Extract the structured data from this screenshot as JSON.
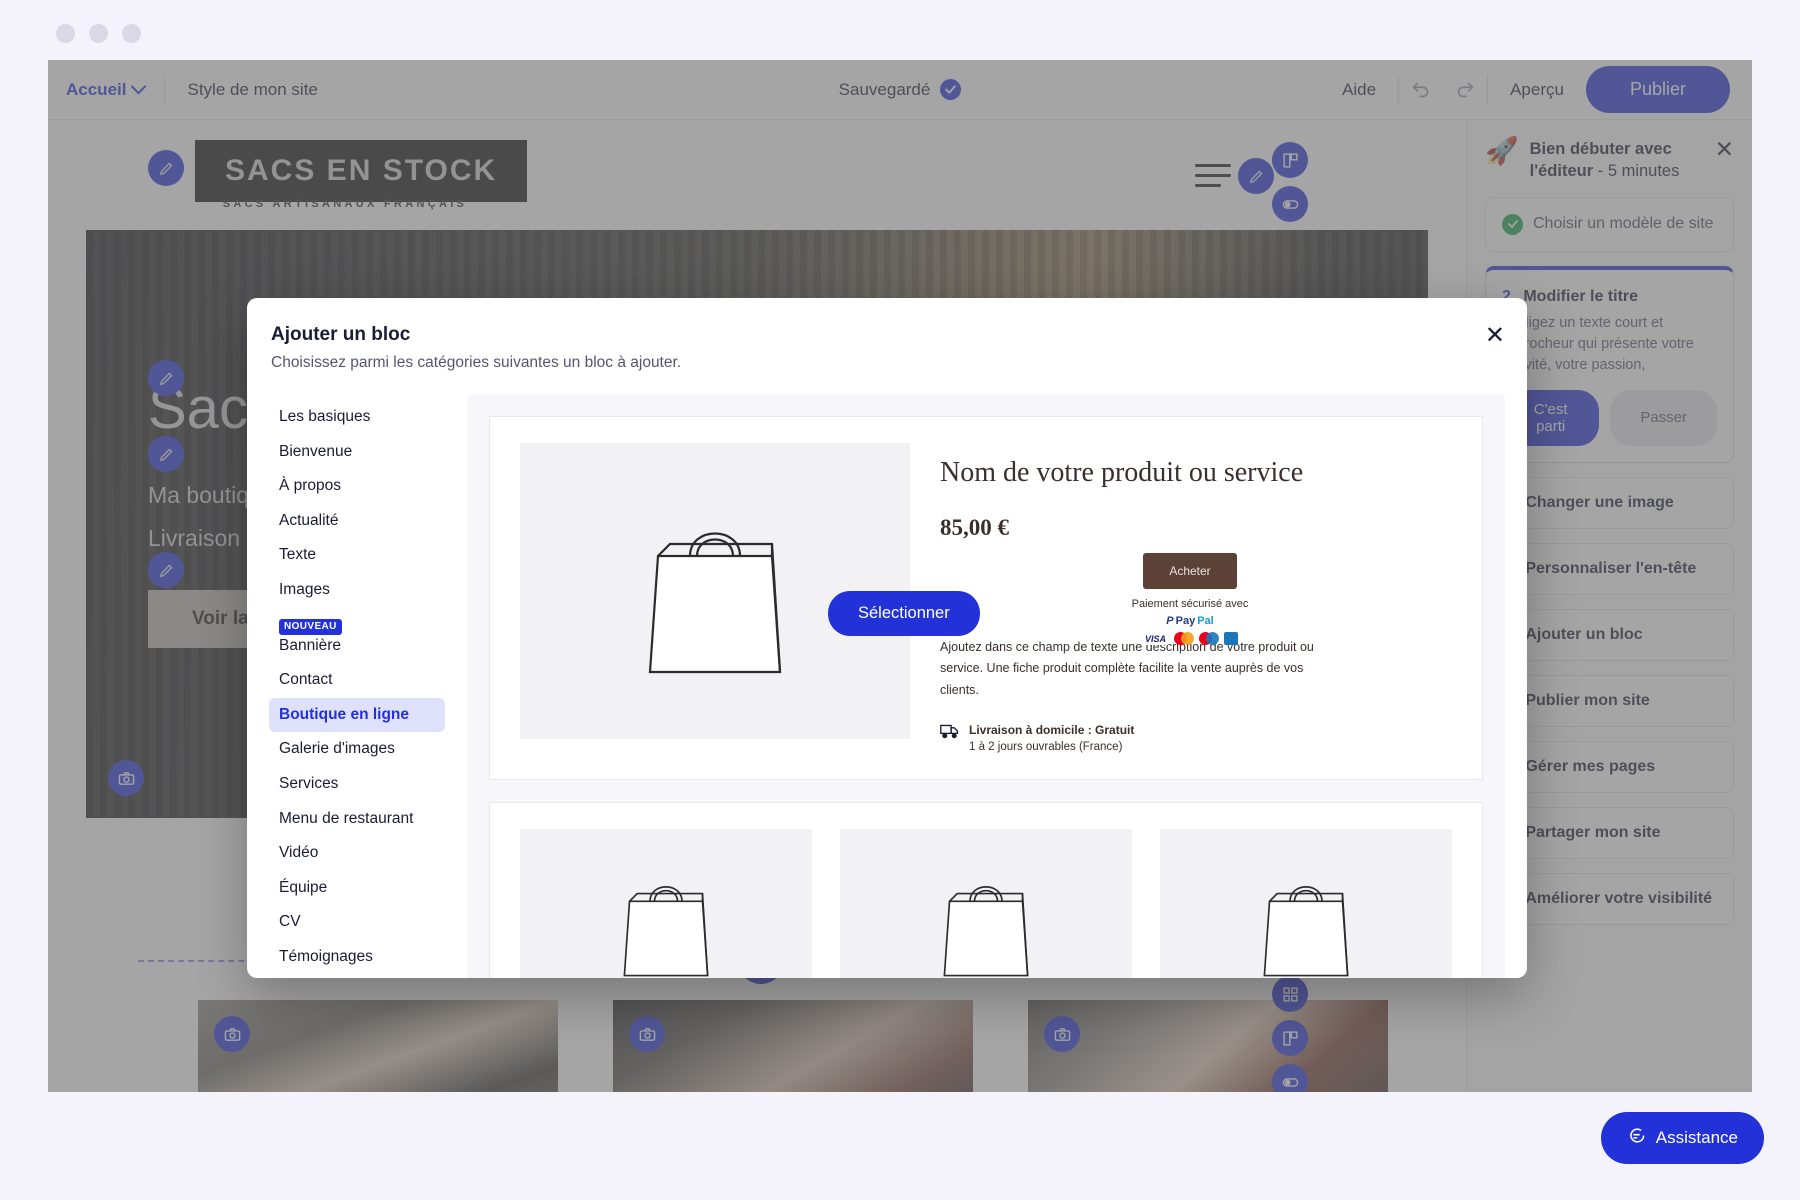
{
  "topbar": {
    "accueil": "Accueil",
    "chevron_icon": "chevron-down-icon",
    "style_label": "Style de mon site",
    "saved_label": "Sauvegardé",
    "saved_icon": "check-circle-icon",
    "help_label": "Aide",
    "undo_icon": "undo-icon",
    "redo_icon": "redo-icon",
    "preview_label": "Aperçu",
    "publish_label": "Publier"
  },
  "site": {
    "logo_text": "SACS EN STOCK",
    "logo_tagline": "SACS ARTISANAUX FRANÇAIS",
    "menu_icon": "hamburger-menu-icon",
    "hero_title": "Sacs",
    "hero_line1": "Ma boutique",
    "hero_line2": "Livraison g",
    "hero_button": "Voir la b",
    "camera_icon": "camera-icon",
    "pencil_icon": "pencil-edit-icon",
    "add_block_icon": "plus-icon"
  },
  "right_panel": {
    "title_bold": "Bien débuter avec l'éditeur",
    "title_rest": " - 5 minutes",
    "rocket_icon": "rocket-icon",
    "close_icon": "close-icon",
    "items": [
      {
        "label": "Choisir un modèle de site",
        "state": "done"
      },
      {
        "label": "Modifier le titre",
        "state": "active",
        "desc": "Rédigez un texte court et accrocheur qui présente votre activité, votre passion,",
        "cta": "C'est parti",
        "skip": "Passer"
      },
      {
        "label": "Changer une image",
        "state": "todo"
      },
      {
        "label": "Personnaliser l'en-tête",
        "state": "todo"
      },
      {
        "label": "Ajouter un bloc",
        "state": "todo"
      },
      {
        "label": "Publier mon site",
        "state": "todo"
      },
      {
        "label": "Gérer mes pages",
        "state": "todo"
      },
      {
        "label": "Partager mon site",
        "state": "todo"
      },
      {
        "label": "Améliorer votre visibilité",
        "state": "todo"
      }
    ],
    "assistance_label": "Assistance",
    "assistance_icon": "chat-bubble-icon"
  },
  "modal": {
    "title": "Ajouter un bloc",
    "subtitle": "Choisissez parmi les catégories suivantes un bloc à ajouter.",
    "close_icon": "close-icon",
    "categories": [
      {
        "label": "Les basiques",
        "selected": false
      },
      {
        "label": "Bienvenue",
        "selected": false
      },
      {
        "label": "À propos",
        "selected": false
      },
      {
        "label": "Actualité",
        "selected": false
      },
      {
        "label": "Texte",
        "selected": false
      },
      {
        "label": "Images",
        "selected": false
      },
      {
        "label": "Bannière",
        "selected": false,
        "badge": "NOUVEAU"
      },
      {
        "label": "Contact",
        "selected": false
      },
      {
        "label": "Boutique en ligne",
        "selected": true
      },
      {
        "label": "Galerie d'images",
        "selected": false
      },
      {
        "label": "Services",
        "selected": false
      },
      {
        "label": "Menu de restaurant",
        "selected": false
      },
      {
        "label": "Vidéo",
        "selected": false
      },
      {
        "label": "Équipe",
        "selected": false
      },
      {
        "label": "CV",
        "selected": false
      },
      {
        "label": "Témoignages",
        "selected": false
      }
    ],
    "preview": {
      "select_button": "Sélectionner",
      "product_name": "Nom de votre produit ou service",
      "product_price": "85,00 €",
      "buy_button": "Acheter",
      "secure_text": "Paiement sécurisé avec",
      "paypal_label_1": "Pay",
      "paypal_label_2": "Pal",
      "visa_label": "VISA",
      "description": "Ajoutez dans ce champ de texte une description de votre produit ou service. Une fiche produit complète facilite la vente auprès de vos clients.",
      "shipping_icon": "delivery-truck-icon",
      "shipping_title": "Livraison à domicile : Gratuit",
      "shipping_sub": "1 à 2 jours ouvrables (France)",
      "bag_icon": "shopping-bag-icon"
    }
  },
  "colors": {
    "accent": "#2331d8",
    "selected_bg": "#dfe1fb",
    "done_green": "#19a44a",
    "brown": "#5b4136"
  }
}
